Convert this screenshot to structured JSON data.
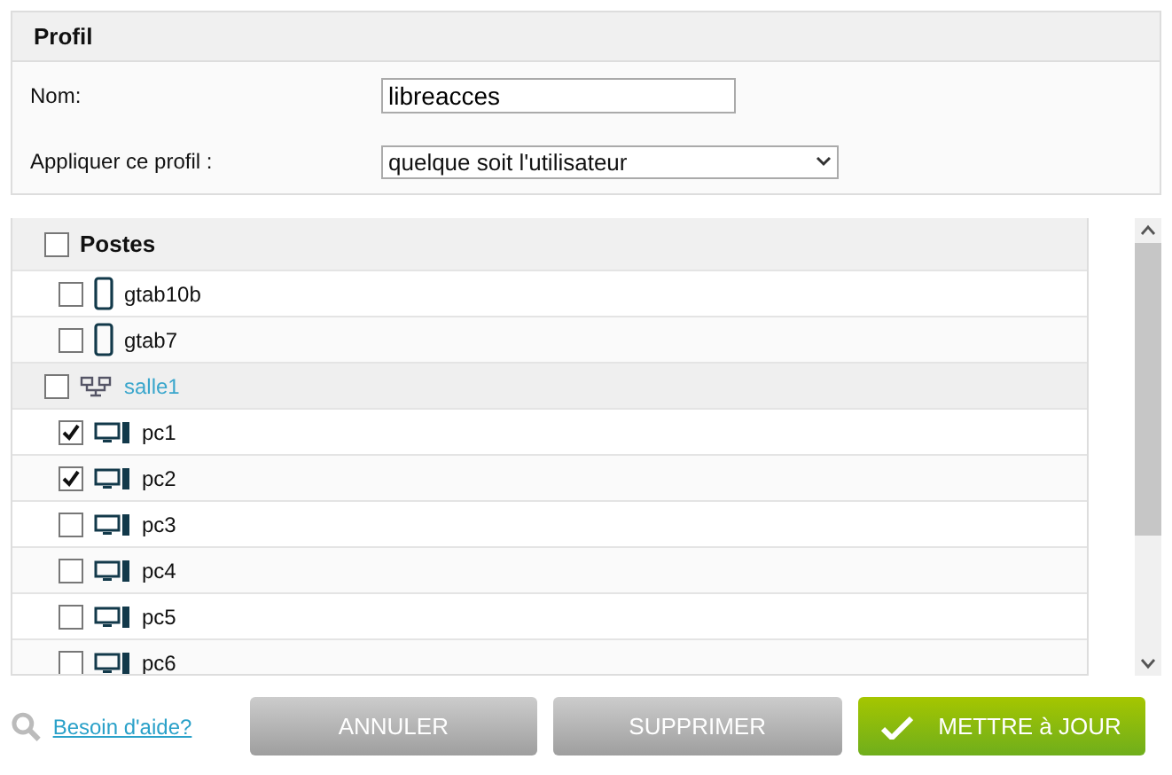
{
  "profile": {
    "title": "Profil",
    "fields": [
      {
        "kind": "text",
        "label": "Nom:",
        "value": "libreacces"
      },
      {
        "kind": "select",
        "label": "Appliquer ce profil :",
        "value": "quelque soit l'utilisateur"
      }
    ]
  },
  "tree": {
    "label": "Postes",
    "checked": false,
    "children": [
      {
        "kind": "tablet",
        "label": "gtab10b",
        "checked": false
      },
      {
        "kind": "tablet",
        "label": "gtab7",
        "checked": false
      },
      {
        "kind": "group",
        "label": "salle1",
        "checked": false,
        "children": [
          {
            "kind": "computer",
            "label": "pc1",
            "checked": true
          },
          {
            "kind": "computer",
            "label": "pc2",
            "checked": true
          },
          {
            "kind": "computer",
            "label": "pc3",
            "checked": false
          },
          {
            "kind": "computer",
            "label": "pc4",
            "checked": false
          },
          {
            "kind": "computer",
            "label": "pc5",
            "checked": false
          },
          {
            "kind": "computer",
            "label": "pc6",
            "checked": false
          }
        ]
      }
    ]
  },
  "footer": {
    "help_link": "Besoin d'aide?",
    "buttons": [
      {
        "kind": "cancel",
        "label": "ANNULER"
      },
      {
        "kind": "delete",
        "label": "SUPPRIMER"
      },
      {
        "kind": "update",
        "label": "METTRE à JOUR"
      }
    ]
  }
}
